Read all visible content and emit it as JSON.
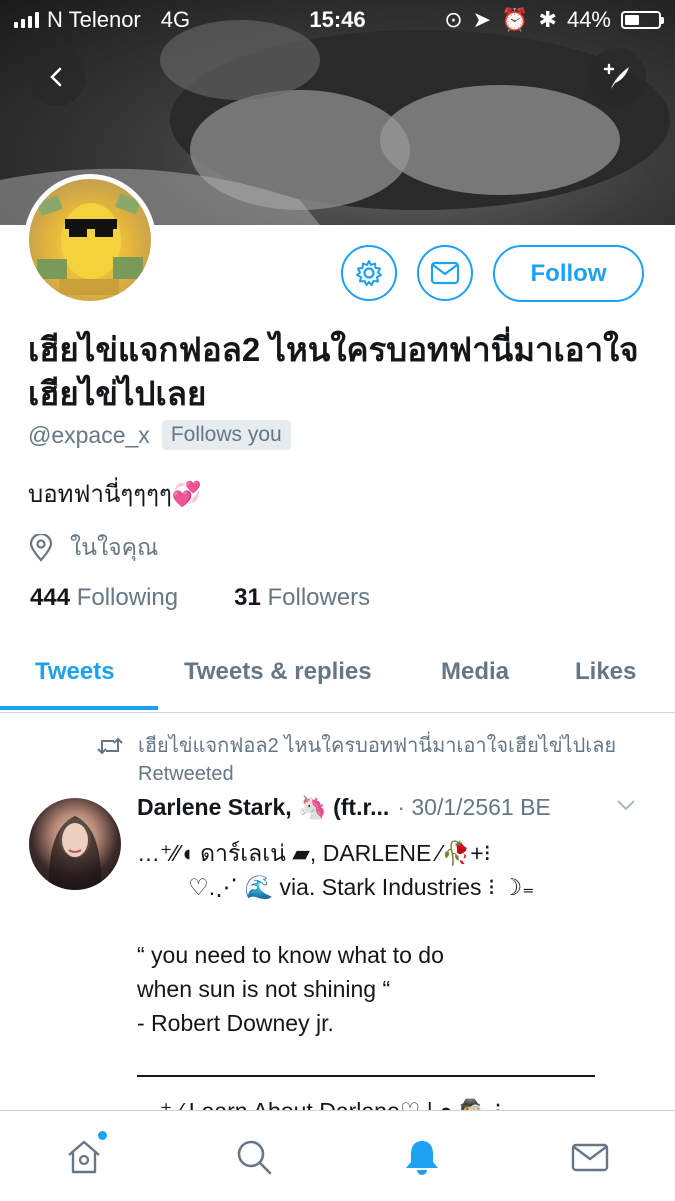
{
  "status_bar": {
    "carrier": "N Telenor",
    "network": "4G",
    "time": "15:46",
    "battery": "44%",
    "battery_level": 0.44
  },
  "header": {
    "back_icon": "back-arrow-icon",
    "compose_icon": "compose-tweet-icon"
  },
  "profile": {
    "display_name": "เฮียไข่แจกฟอล2 ไหนใครบอทฟานี่มาเอาใจเฮียไข่ไปเลย",
    "handle": "@expace_x",
    "follows_you": "Follows you",
    "bio": "บอทฟานี่ๆๆๆๆ💞",
    "location": "ในใจคุณ",
    "following_count": "444",
    "following_label": "Following",
    "followers_count": "31",
    "followers_label": "Followers",
    "follow_button": "Follow"
  },
  "tabs": [
    {
      "label": "Tweets",
      "active": true
    },
    {
      "label": "Tweets & replies",
      "active": false
    },
    {
      "label": "Media",
      "active": false
    },
    {
      "label": "Likes",
      "active": false
    }
  ],
  "tweet": {
    "retweet_context": "เฮียไข่แจกฟอล2 ไหนใครบอทฟานี่มาเอาใจเฮียไข่ไปเลย Retweeted",
    "author": "Darlene Stark, 🦄 (ft.r...",
    "date": "· 30/1/2561 BE",
    "line1": "…⁺⁄⁄◖ ดาร์เลเน่ ▰, DARLENE ⁄🥀+⁝",
    "line2": "        ♡.⋰ 🌊 via. Stark Industries ⁝ ☽₌",
    "line3": "",
    "line4": "“ you need to know what to do",
    "line5": "when sun is not shining “",
    "line6": "- Robert Downey jr.",
    "cut_line": "…⁺ ⁄ Learn About Darlene♡ | ● 🕵 ⁝"
  },
  "bottom_nav": [
    {
      "name": "home",
      "icon": "home-icon",
      "active": false,
      "badge": true
    },
    {
      "name": "search",
      "icon": "search-icon",
      "active": false
    },
    {
      "name": "notifications",
      "icon": "bell-icon",
      "active": true
    },
    {
      "name": "messages",
      "icon": "envelope-icon",
      "active": false
    }
  ],
  "colors": {
    "accent": "#1da1f2",
    "muted": "#657786",
    "text": "#14171a"
  }
}
